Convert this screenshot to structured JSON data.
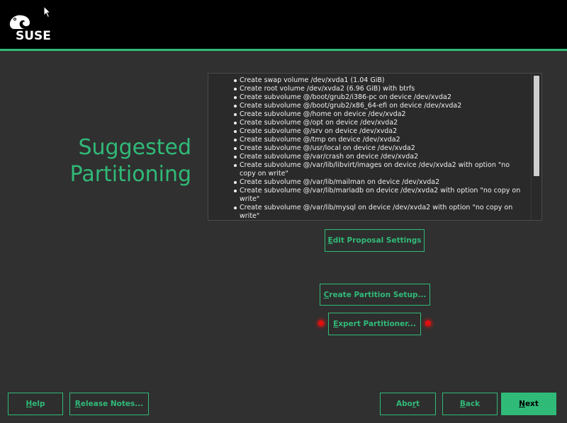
{
  "brand": {
    "name": "SUSE",
    "icon": "chameleon-icon"
  },
  "page_title": {
    "line1": "Suggested",
    "line2": "Partitioning"
  },
  "summary_items": [
    "Create swap volume /dev/xvda1 (1.04 GiB)",
    "Create root volume /dev/xvda2 (6.96 GiB) with btrfs",
    "Create subvolume @/boot/grub2/i386-pc on device /dev/xvda2",
    "Create subvolume @/boot/grub2/x86_64-efi on device /dev/xvda2",
    "Create subvolume @/home on device /dev/xvda2",
    "Create subvolume @/opt on device /dev/xvda2",
    "Create subvolume @/srv on device /dev/xvda2",
    "Create subvolume @/tmp on device /dev/xvda2",
    "Create subvolume @/usr/local on device /dev/xvda2",
    "Create subvolume @/var/crash on device /dev/xvda2",
    "Create subvolume @/var/lib/libvirt/images on device /dev/xvda2 with option \"no copy on write\"",
    "Create subvolume @/var/lib/mailman on device /dev/xvda2",
    "Create subvolume @/var/lib/mariadb on device /dev/xvda2 with option \"no copy on write\"",
    "Create subvolume @/var/lib/mysql on device /dev/xvda2 with option \"no copy on write\""
  ],
  "buttons": {
    "edit_proposal": {
      "mnemonic": "E",
      "rest": "dit Proposal Settings"
    },
    "create_setup": {
      "mnemonic": "C",
      "rest": "reate Partition Setup..."
    },
    "expert": {
      "mnemonic": "E",
      "rest": "xpert Partitioner..."
    }
  },
  "footer": {
    "help": {
      "mnemonic": "H",
      "rest": "elp"
    },
    "release_notes": {
      "mnemonic": "R",
      "rest": "elease Notes..."
    },
    "abort": {
      "pre": "Abo",
      "mnemonic": "r",
      "rest": "t"
    },
    "back": {
      "mnemonic": "B",
      "rest": "ack"
    },
    "next": {
      "mnemonic": "N",
      "rest": "ext"
    }
  },
  "colors": {
    "accent": "#30ba78",
    "background": "#303030",
    "topbar": "#000000",
    "highlight_dot": "#e01010"
  }
}
